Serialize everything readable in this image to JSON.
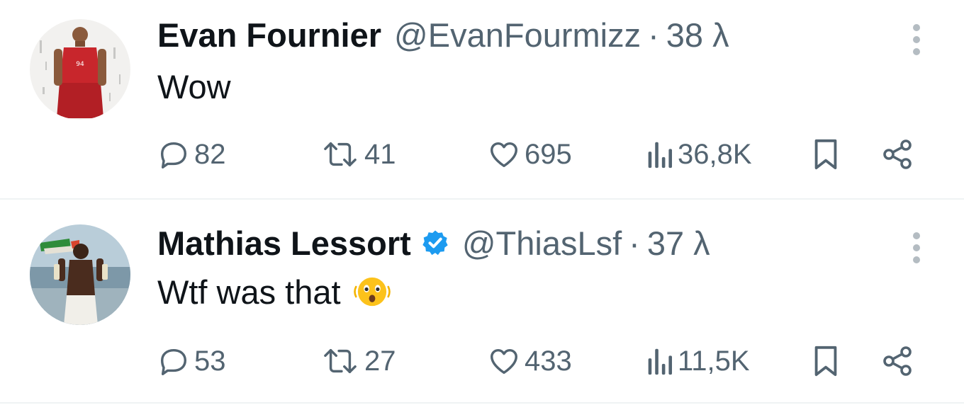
{
  "tweets": [
    {
      "name": "Evan Fournier",
      "verified": false,
      "handle": "@EvanFourmizz",
      "separator": "·",
      "time": "38 λ",
      "text": "Wow",
      "emoji": "",
      "replies": "82",
      "retweets": "41",
      "likes": "695",
      "views": "36,8K"
    },
    {
      "name": "Mathias Lessort",
      "verified": true,
      "handle": "@ThiasLsf",
      "separator": "·",
      "time": "37 λ",
      "text": "Wtf was that",
      "emoji": "astonished-face-emoji",
      "replies": "53",
      "retweets": "27",
      "likes": "433",
      "views": "11,5K"
    }
  ],
  "colors": {
    "text": "#0f1419",
    "secondary": "#536471",
    "verified": "#1d9bf0",
    "divider": "#eff3f4"
  },
  "icons": [
    "reply-icon",
    "retweet-icon",
    "like-icon",
    "views-icon",
    "bookmark-icon",
    "share-icon",
    "more-icon",
    "verified-badge-icon"
  ]
}
